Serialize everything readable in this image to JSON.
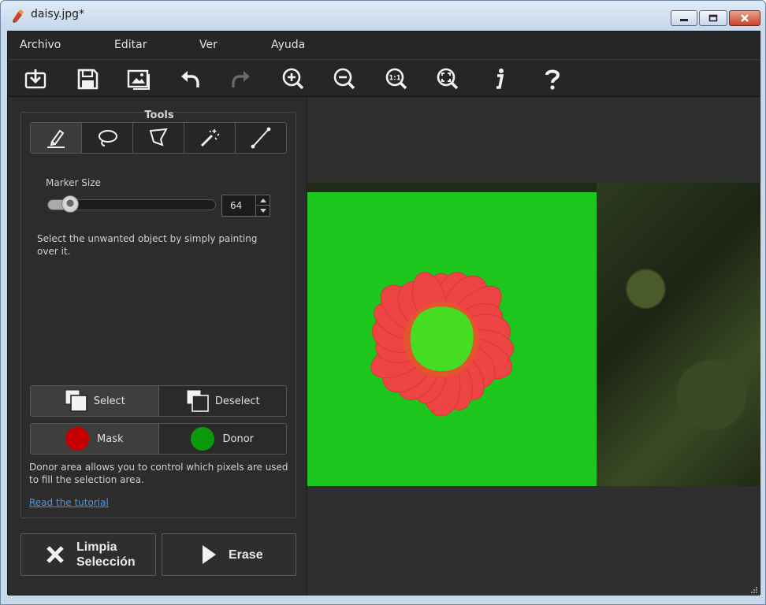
{
  "window": {
    "title": "daisy.jpg*"
  },
  "menu": {
    "items": [
      "Archivo",
      "Editar",
      "Ver",
      "Ayuda"
    ]
  },
  "toolbar": {
    "icons": [
      "import-icon",
      "save-icon",
      "image-icon",
      "undo-icon",
      "redo-icon",
      "zoom-in-icon",
      "zoom-out-icon",
      "zoom-actual-icon",
      "zoom-fit-icon",
      "info-icon",
      "help-icon"
    ]
  },
  "tools": {
    "title": "Tools",
    "buttons": [
      "marker-icon",
      "lasso-icon",
      "polygon-lasso-icon",
      "magic-wand-icon",
      "line-icon"
    ],
    "active_index": 0
  },
  "marker": {
    "label": "Marker Size",
    "value": "64",
    "slider_fraction": 0.12
  },
  "instructions": "Select the unwanted object by simply painting over it.",
  "selection_mode": {
    "select_label": "Select",
    "deselect_label": "Deselect",
    "active": "select"
  },
  "area_mode": {
    "mask_label": "Mask",
    "donor_label": "Donor",
    "mask_color": "#c40000",
    "donor_color": "#0a9a0a"
  },
  "donor_text": "Donor area allows you to control which pixels are used to fill the selection area.",
  "tutorial_link": "Read the tutorial",
  "actions": {
    "clear_line1": "Limpia",
    "clear_line2": "Selección",
    "erase_label": "Erase"
  },
  "colors": {
    "accent_link": "#4f97e0",
    "mask_overlay": "#ee4444",
    "donor_overlay": "#1cc61c"
  }
}
